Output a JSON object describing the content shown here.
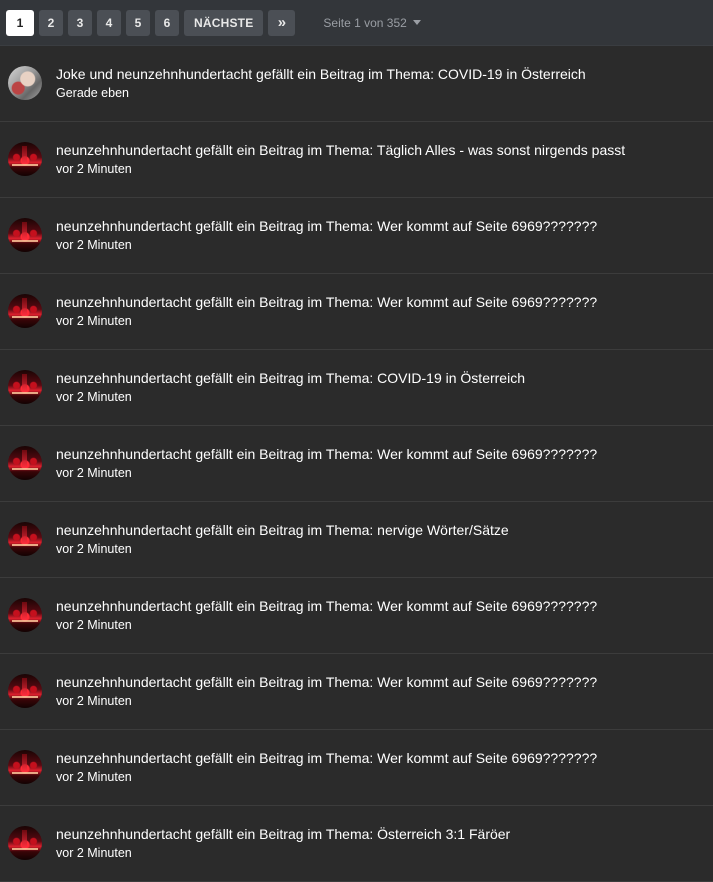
{
  "pagination": {
    "pages": [
      "1",
      "2",
      "3",
      "4",
      "5",
      "6"
    ],
    "current_page": "1",
    "next_label": "NÄCHSTE",
    "last_label": "»",
    "page_info": "Seite 1 von 352"
  },
  "activities": [
    {
      "text": "Joke und neunzehnhundertacht gefällt ein Beitrag im Thema: COVID-19 in Österreich",
      "time": "Gerade eben",
      "avatar": "photo"
    },
    {
      "text": "neunzehnhundertacht gefällt ein Beitrag im Thema: Täglich Alles - was sonst nirgends passt",
      "time": "vor 2 Minuten",
      "avatar": "red"
    },
    {
      "text": "neunzehnhundertacht gefällt ein Beitrag im Thema: Wer kommt auf Seite 6969???????",
      "time": "vor 2 Minuten",
      "avatar": "red"
    },
    {
      "text": "neunzehnhundertacht gefällt ein Beitrag im Thema: Wer kommt auf Seite 6969???????",
      "time": "vor 2 Minuten",
      "avatar": "red"
    },
    {
      "text": "neunzehnhundertacht gefällt ein Beitrag im Thema: COVID-19 in Österreich",
      "time": "vor 2 Minuten",
      "avatar": "red"
    },
    {
      "text": "neunzehnhundertacht gefällt ein Beitrag im Thema: Wer kommt auf Seite 6969???????",
      "time": "vor 2 Minuten",
      "avatar": "red"
    },
    {
      "text": "neunzehnhundertacht gefällt ein Beitrag im Thema: nervige Wörter/Sätze",
      "time": "vor 2 Minuten",
      "avatar": "red"
    },
    {
      "text": "neunzehnhundertacht gefällt ein Beitrag im Thema: Wer kommt auf Seite 6969???????",
      "time": "vor 2 Minuten",
      "avatar": "red"
    },
    {
      "text": "neunzehnhundertacht gefällt ein Beitrag im Thema: Wer kommt auf Seite 6969???????",
      "time": "vor 2 Minuten",
      "avatar": "red"
    },
    {
      "text": "neunzehnhundertacht gefällt ein Beitrag im Thema: Wer kommt auf Seite 6969???????",
      "time": "vor 2 Minuten",
      "avatar": "red"
    },
    {
      "text": "neunzehnhundertacht gefällt ein Beitrag im Thema: Österreich 3:1 Färöer",
      "time": "vor 2 Minuten",
      "avatar": "red"
    }
  ]
}
